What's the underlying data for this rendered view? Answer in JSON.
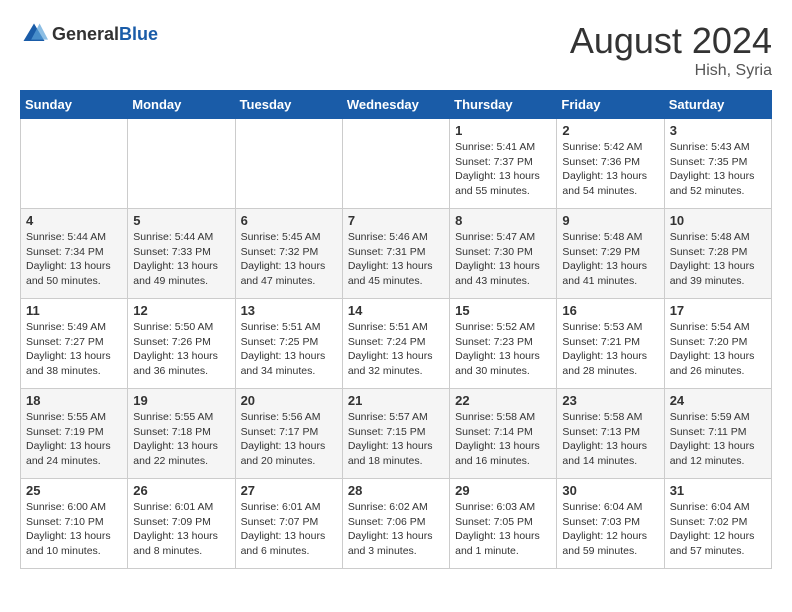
{
  "header": {
    "logo_general": "General",
    "logo_blue": "Blue",
    "month_year": "August 2024",
    "location": "Hish, Syria"
  },
  "weekdays": [
    "Sunday",
    "Monday",
    "Tuesday",
    "Wednesday",
    "Thursday",
    "Friday",
    "Saturday"
  ],
  "weeks": [
    [
      {
        "day": "",
        "info": ""
      },
      {
        "day": "",
        "info": ""
      },
      {
        "day": "",
        "info": ""
      },
      {
        "day": "",
        "info": ""
      },
      {
        "day": "1",
        "info": "Sunrise: 5:41 AM\nSunset: 7:37 PM\nDaylight: 13 hours\nand 55 minutes."
      },
      {
        "day": "2",
        "info": "Sunrise: 5:42 AM\nSunset: 7:36 PM\nDaylight: 13 hours\nand 54 minutes."
      },
      {
        "day": "3",
        "info": "Sunrise: 5:43 AM\nSunset: 7:35 PM\nDaylight: 13 hours\nand 52 minutes."
      }
    ],
    [
      {
        "day": "4",
        "info": "Sunrise: 5:44 AM\nSunset: 7:34 PM\nDaylight: 13 hours\nand 50 minutes."
      },
      {
        "day": "5",
        "info": "Sunrise: 5:44 AM\nSunset: 7:33 PM\nDaylight: 13 hours\nand 49 minutes."
      },
      {
        "day": "6",
        "info": "Sunrise: 5:45 AM\nSunset: 7:32 PM\nDaylight: 13 hours\nand 47 minutes."
      },
      {
        "day": "7",
        "info": "Sunrise: 5:46 AM\nSunset: 7:31 PM\nDaylight: 13 hours\nand 45 minutes."
      },
      {
        "day": "8",
        "info": "Sunrise: 5:47 AM\nSunset: 7:30 PM\nDaylight: 13 hours\nand 43 minutes."
      },
      {
        "day": "9",
        "info": "Sunrise: 5:48 AM\nSunset: 7:29 PM\nDaylight: 13 hours\nand 41 minutes."
      },
      {
        "day": "10",
        "info": "Sunrise: 5:48 AM\nSunset: 7:28 PM\nDaylight: 13 hours\nand 39 minutes."
      }
    ],
    [
      {
        "day": "11",
        "info": "Sunrise: 5:49 AM\nSunset: 7:27 PM\nDaylight: 13 hours\nand 38 minutes."
      },
      {
        "day": "12",
        "info": "Sunrise: 5:50 AM\nSunset: 7:26 PM\nDaylight: 13 hours\nand 36 minutes."
      },
      {
        "day": "13",
        "info": "Sunrise: 5:51 AM\nSunset: 7:25 PM\nDaylight: 13 hours\nand 34 minutes."
      },
      {
        "day": "14",
        "info": "Sunrise: 5:51 AM\nSunset: 7:24 PM\nDaylight: 13 hours\nand 32 minutes."
      },
      {
        "day": "15",
        "info": "Sunrise: 5:52 AM\nSunset: 7:23 PM\nDaylight: 13 hours\nand 30 minutes."
      },
      {
        "day": "16",
        "info": "Sunrise: 5:53 AM\nSunset: 7:21 PM\nDaylight: 13 hours\nand 28 minutes."
      },
      {
        "day": "17",
        "info": "Sunrise: 5:54 AM\nSunset: 7:20 PM\nDaylight: 13 hours\nand 26 minutes."
      }
    ],
    [
      {
        "day": "18",
        "info": "Sunrise: 5:55 AM\nSunset: 7:19 PM\nDaylight: 13 hours\nand 24 minutes."
      },
      {
        "day": "19",
        "info": "Sunrise: 5:55 AM\nSunset: 7:18 PM\nDaylight: 13 hours\nand 22 minutes."
      },
      {
        "day": "20",
        "info": "Sunrise: 5:56 AM\nSunset: 7:17 PM\nDaylight: 13 hours\nand 20 minutes."
      },
      {
        "day": "21",
        "info": "Sunrise: 5:57 AM\nSunset: 7:15 PM\nDaylight: 13 hours\nand 18 minutes."
      },
      {
        "day": "22",
        "info": "Sunrise: 5:58 AM\nSunset: 7:14 PM\nDaylight: 13 hours\nand 16 minutes."
      },
      {
        "day": "23",
        "info": "Sunrise: 5:58 AM\nSunset: 7:13 PM\nDaylight: 13 hours\nand 14 minutes."
      },
      {
        "day": "24",
        "info": "Sunrise: 5:59 AM\nSunset: 7:11 PM\nDaylight: 13 hours\nand 12 minutes."
      }
    ],
    [
      {
        "day": "25",
        "info": "Sunrise: 6:00 AM\nSunset: 7:10 PM\nDaylight: 13 hours\nand 10 minutes."
      },
      {
        "day": "26",
        "info": "Sunrise: 6:01 AM\nSunset: 7:09 PM\nDaylight: 13 hours\nand 8 minutes."
      },
      {
        "day": "27",
        "info": "Sunrise: 6:01 AM\nSunset: 7:07 PM\nDaylight: 13 hours\nand 6 minutes."
      },
      {
        "day": "28",
        "info": "Sunrise: 6:02 AM\nSunset: 7:06 PM\nDaylight: 13 hours\nand 3 minutes."
      },
      {
        "day": "29",
        "info": "Sunrise: 6:03 AM\nSunset: 7:05 PM\nDaylight: 13 hours\nand 1 minute."
      },
      {
        "day": "30",
        "info": "Sunrise: 6:04 AM\nSunset: 7:03 PM\nDaylight: 12 hours\nand 59 minutes."
      },
      {
        "day": "31",
        "info": "Sunrise: 6:04 AM\nSunset: 7:02 PM\nDaylight: 12 hours\nand 57 minutes."
      }
    ]
  ]
}
